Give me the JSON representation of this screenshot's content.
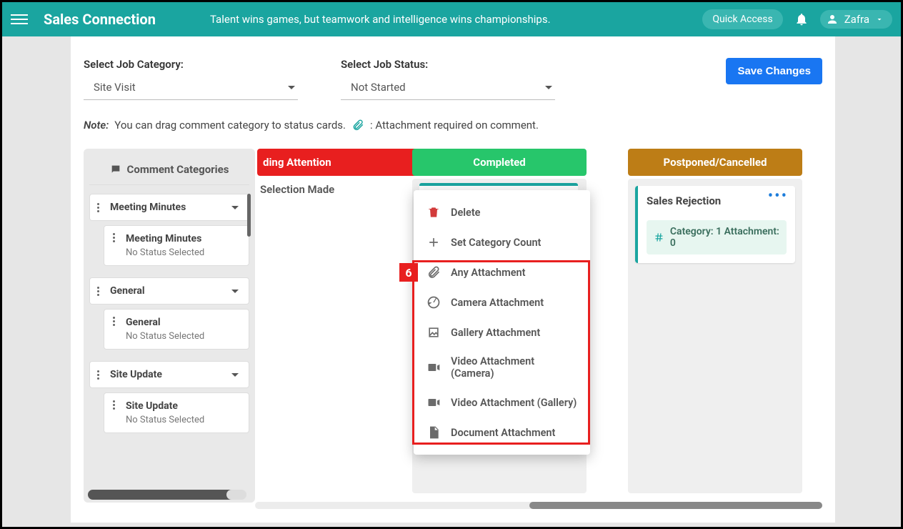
{
  "header": {
    "brand": "Sales Connection",
    "tagline": "Talent wins games, but teamwork and intelligence wins championships.",
    "quick_access": "Quick Access",
    "user_name": "Zafra"
  },
  "selectors": {
    "job_category_label": "Select Job Category:",
    "job_category_value": "Site Visit",
    "job_status_label": "Select Job Status:",
    "job_status_value": "Not Started"
  },
  "buttons": {
    "save_changes": "Save Changes"
  },
  "note": {
    "label": "Note:",
    "text": "You can drag comment category to status cards.",
    "attach_text": ": Attachment required on comment."
  },
  "cat_panel": {
    "title": "Comment Categories",
    "groups": [
      {
        "name": "Meeting Minutes",
        "sub_title": "Meeting Minutes",
        "sub_status": "No Status Selected"
      },
      {
        "name": "General",
        "sub_title": "General",
        "sub_status": "No Status Selected"
      },
      {
        "name": "Site Update",
        "sub_title": "Site Update",
        "sub_status": "No Status Selected"
      }
    ]
  },
  "columns": {
    "needing": {
      "header": "ding Attention",
      "row_text": "Selection Made"
    },
    "completed": {
      "header": "Completed"
    },
    "postponed": {
      "header": "Postponed/Cancelled",
      "card_title": "Sales Rejection",
      "badge_text": "Category: 1 Attachment: 0"
    }
  },
  "ctx_menu": {
    "delete": "Delete",
    "set_count": "Set Category Count",
    "any": "Any Attachment",
    "camera": "Camera Attachment",
    "gallery": "Gallery Attachment",
    "video_cam": "Video Attachment (Camera)",
    "video_gal": "Video Attachment (Gallery)",
    "document": "Document Attachment"
  },
  "callout": {
    "six": "6"
  }
}
